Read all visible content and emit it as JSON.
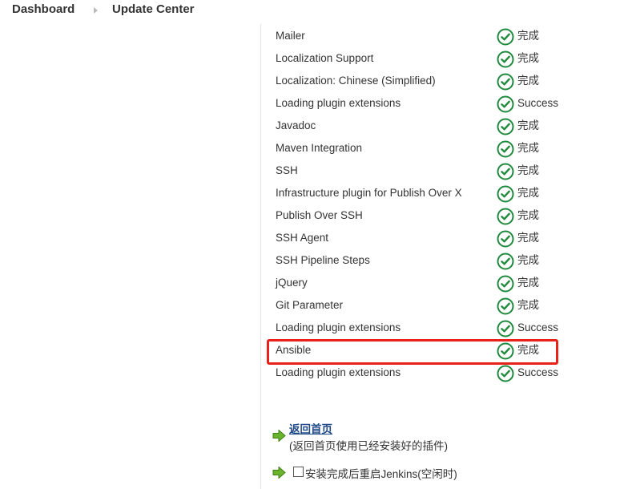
{
  "breadcrumb": {
    "home": "Dashboard",
    "current": "Update Center"
  },
  "plugins": [
    {
      "name": "Mailer",
      "status": "完成"
    },
    {
      "name": "Localization Support",
      "status": "完成"
    },
    {
      "name": "Localization: Chinese (Simplified)",
      "status": "完成"
    },
    {
      "name": "Loading plugin extensions",
      "status": "Success"
    },
    {
      "name": "Javadoc",
      "status": "完成"
    },
    {
      "name": "Maven Integration",
      "status": "完成"
    },
    {
      "name": "SSH",
      "status": "完成"
    },
    {
      "name": "Infrastructure plugin for Publish Over X",
      "status": "完成"
    },
    {
      "name": "Publish Over SSH",
      "status": "完成"
    },
    {
      "name": "SSH Agent",
      "status": "完成"
    },
    {
      "name": "SSH Pipeline Steps",
      "status": "完成"
    },
    {
      "name": "jQuery",
      "status": "完成"
    },
    {
      "name": "Git Parameter",
      "status": "完成"
    },
    {
      "name": "Loading plugin extensions",
      "status": "Success"
    },
    {
      "name": "Ansible",
      "status": "完成"
    },
    {
      "name": "Loading plugin extensions",
      "status": "Success"
    }
  ],
  "status_icon": "check-circle-icon",
  "colors": {
    "success_green": "#1f8a3c",
    "highlight_red": "#e8221b",
    "link_blue": "#204a87",
    "arrow_green": "#6ab42d"
  },
  "actions": {
    "back_link": "返回首页",
    "back_desc": "(返回首页使用已经安装好的插件)",
    "restart_label": "安装完成后重启Jenkins(空闲时)",
    "restart_checked": false
  }
}
